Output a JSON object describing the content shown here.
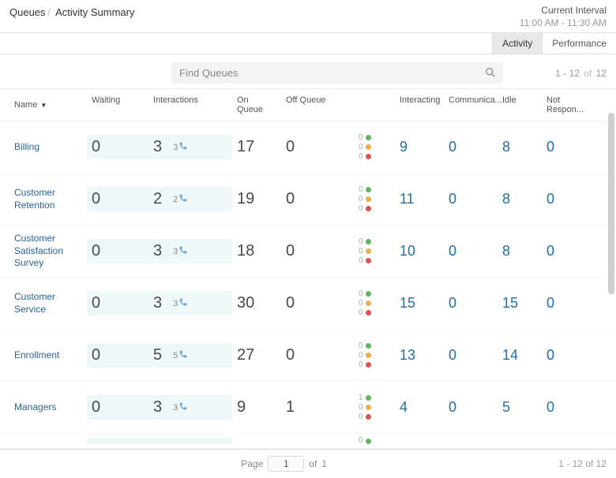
{
  "header": {
    "breadcrumb_root": "Queues",
    "breadcrumb_current": "Activity Summary",
    "interval_label": "Current Interval",
    "interval_time": "11:00 AM - 11:30 AM"
  },
  "tabs": {
    "activity": "Activity",
    "performance": "Performance"
  },
  "search": {
    "placeholder": "Find Queues",
    "range_start": "1 - 12",
    "range_of": "of",
    "range_total": "12"
  },
  "columns": {
    "name": "Name",
    "waiting": "Waiting",
    "interactions": "Interactions",
    "on_queue": "On Queue",
    "off_queue": "Off Queue",
    "interacting": "Interacting",
    "communicating": "Communica...",
    "idle": "Idle",
    "not_responding": "Not Respon..."
  },
  "rows": [
    {
      "name": "Billing",
      "waiting": "0",
      "interactions": "3",
      "interactions_mini": "3",
      "on_queue": "17",
      "off_queue": "0",
      "status": [
        "0",
        "0",
        "0"
      ],
      "interacting": "9",
      "communicating": "0",
      "idle": "8",
      "not_responding": "0"
    },
    {
      "name": "Customer Retention",
      "waiting": "0",
      "interactions": "2",
      "interactions_mini": "2",
      "on_queue": "19",
      "off_queue": "0",
      "status": [
        "0",
        "0",
        "0"
      ],
      "interacting": "11",
      "communicating": "0",
      "idle": "8",
      "not_responding": "0"
    },
    {
      "name": "Customer Satisfaction Survey",
      "waiting": "0",
      "interactions": "3",
      "interactions_mini": "3",
      "on_queue": "18",
      "off_queue": "0",
      "status": [
        "0",
        "0",
        "0"
      ],
      "interacting": "10",
      "communicating": "0",
      "idle": "8",
      "not_responding": "0"
    },
    {
      "name": "Customer Service",
      "waiting": "0",
      "interactions": "3",
      "interactions_mini": "3",
      "on_queue": "30",
      "off_queue": "0",
      "status": [
        "0",
        "0",
        "0"
      ],
      "interacting": "15",
      "communicating": "0",
      "idle": "15",
      "not_responding": "0"
    },
    {
      "name": "Enrollment",
      "waiting": "0",
      "interactions": "5",
      "interactions_mini": "5",
      "on_queue": "27",
      "off_queue": "0",
      "status": [
        "0",
        "0",
        "0"
      ],
      "interacting": "13",
      "communicating": "0",
      "idle": "14",
      "not_responding": "0"
    },
    {
      "name": "Managers",
      "waiting": "0",
      "interactions": "3",
      "interactions_mini": "3",
      "on_queue": "9",
      "off_queue": "1",
      "status": [
        "1",
        "0",
        "0"
      ],
      "interacting": "4",
      "communicating": "0",
      "idle": "5",
      "not_responding": "0"
    }
  ],
  "partial_row": {
    "status": [
      "0"
    ]
  },
  "footer": {
    "page_label": "Page",
    "page_value": "1",
    "of_label": "of",
    "total_pages": "1",
    "range_start": "1 - 12",
    "range_of": "of",
    "range_total": "12"
  }
}
